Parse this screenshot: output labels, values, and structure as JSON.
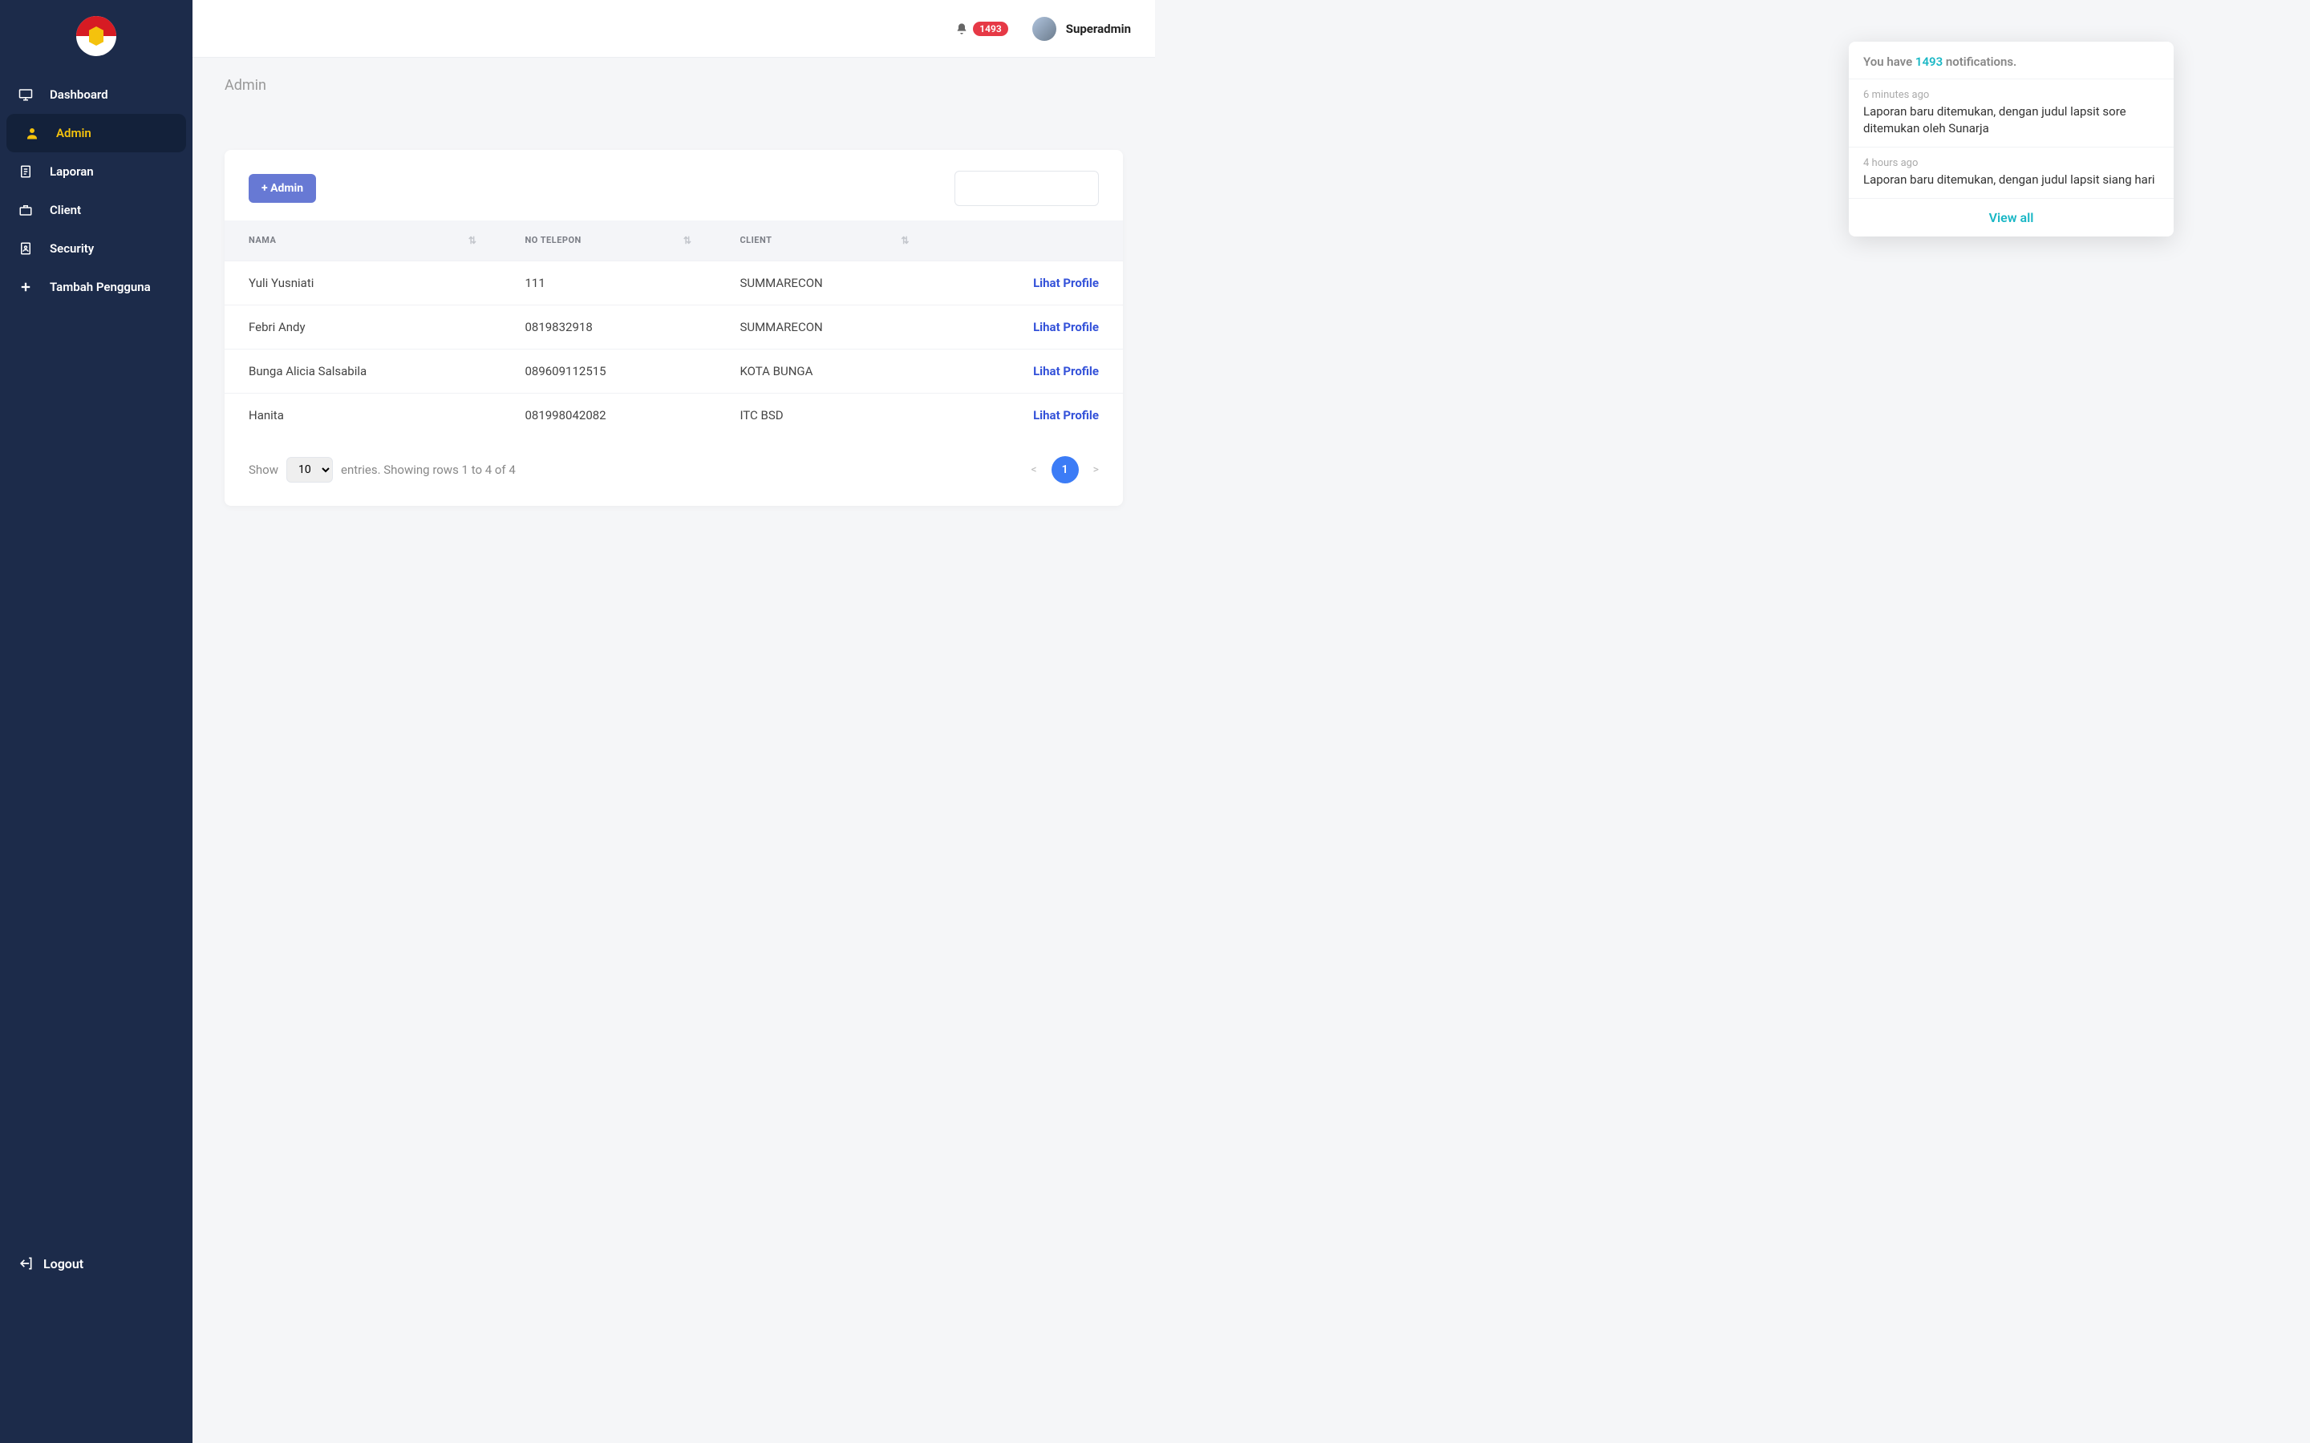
{
  "sidebar": {
    "items": [
      {
        "label": "Dashboard",
        "icon": "monitor-icon"
      },
      {
        "label": "Admin",
        "icon": "user-icon"
      },
      {
        "label": "Laporan",
        "icon": "document-icon"
      },
      {
        "label": "Client",
        "icon": "briefcase-icon"
      },
      {
        "label": "Security",
        "icon": "id-badge-icon"
      },
      {
        "label": "Tambah Pengguna",
        "icon": "plus-icon"
      }
    ],
    "logout_label": "Logout"
  },
  "topbar": {
    "notif_count": "1493",
    "username": "Superadmin"
  },
  "notifications": {
    "head_prefix": "You have ",
    "count": "1493",
    "head_suffix": " notifications.",
    "items": [
      {
        "time": "6 minutes ago",
        "text": "Laporan baru ditemukan, dengan judul lapsit sore ditemukan oleh Sunarja"
      },
      {
        "time": "4 hours ago",
        "text": "Laporan baru ditemukan, dengan judul lapsit siang hari"
      }
    ],
    "view_all": "View all"
  },
  "page": {
    "title": "Admin"
  },
  "card": {
    "add_label": "+ Admin",
    "search_placeholder": ""
  },
  "table": {
    "headers": {
      "nama": "NAMA",
      "telepon": "NO TELEPON",
      "client": "CLIENT"
    },
    "rows": [
      {
        "nama": "Yuli Yusniati",
        "telepon": "111",
        "client": "SUMMARECON",
        "action": "Lihat Profile"
      },
      {
        "nama": "Febri Andy",
        "telepon": "0819832918",
        "client": "SUMMARECON",
        "action": "Lihat Profile"
      },
      {
        "nama": "Bunga Alicia Salsabila",
        "telepon": "089609112515",
        "client": "KOTA BUNGA",
        "action": "Lihat Profile"
      },
      {
        "nama": "Hanita",
        "telepon": "081998042082",
        "client": "ITC BSD",
        "action": "Lihat Profile"
      }
    ]
  },
  "footer": {
    "show_label": "Show",
    "entries_value": "10",
    "entries_text": "entries. Showing rows 1 to 4 of 4",
    "prev": "<",
    "page": "1",
    "next": ">"
  }
}
